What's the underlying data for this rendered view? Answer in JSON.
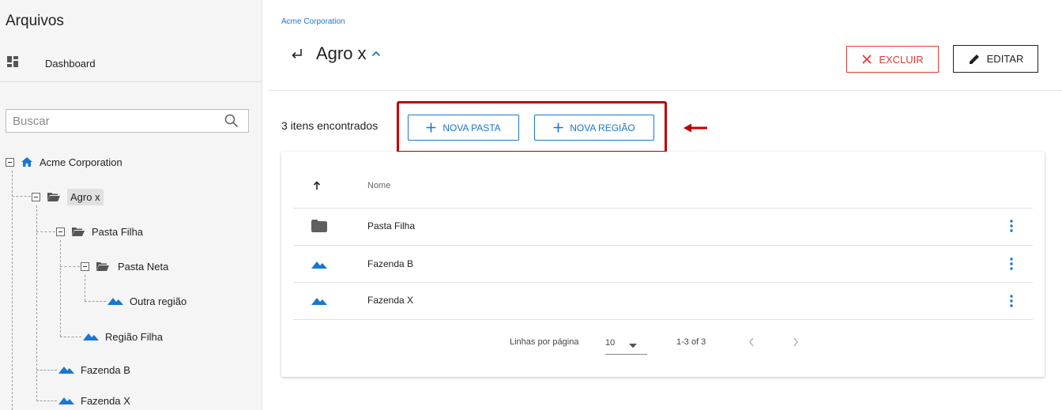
{
  "sidebar": {
    "title": "Arquivos",
    "dashboard_label": "Dashboard",
    "search_placeholder": "Buscar",
    "tree": {
      "root": "Acme Corporation",
      "agro": "Agro x",
      "pasta_filha": "Pasta Filha",
      "pasta_neta": "Pasta Neta",
      "outra_regiao": "Outra região",
      "regiao_filha": "Região Filha",
      "fazenda_b": "Fazenda B",
      "fazenda_x": "Fazenda X"
    }
  },
  "main": {
    "breadcrumb": "Acme Corporation",
    "title": "Agro x",
    "delete_label": "EXCLUIR",
    "edit_label": "EDITAR",
    "items_count": "3 itens encontrados",
    "new_folder_label": "NOVA PASTA",
    "new_region_label": "NOVA REGIÃO",
    "table": {
      "column_name": "Nome",
      "rows": [
        {
          "name": "Pasta Filha",
          "icon": "folder-icon"
        },
        {
          "name": "Fazenda B",
          "icon": "mountain-icon"
        },
        {
          "name": "Fazenda X",
          "icon": "mountain-icon"
        }
      ]
    },
    "pagination": {
      "rows_per_page_label": "Linhas por página",
      "rows_per_page_value": "10",
      "range": "1-3 of 3"
    }
  },
  "colors": {
    "accent": "#1976d2",
    "danger": "#e53935",
    "highlight": "#c00000"
  }
}
